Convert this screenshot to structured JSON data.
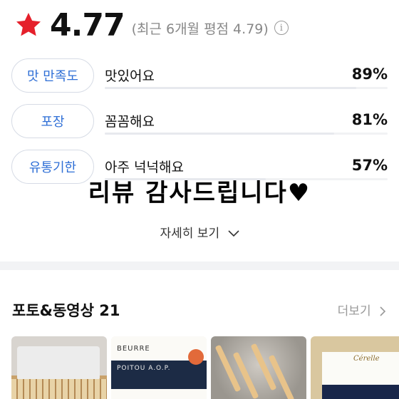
{
  "rating": {
    "score": "4.77",
    "recent_text": "(최근 6개월 평점 4.79)",
    "star_color": "#e5202b",
    "star_icon": "star-icon",
    "info_icon": "info-icon",
    "info_glyph": "i"
  },
  "criteria": [
    {
      "label": "맛 만족도",
      "description": "맛있어요",
      "percent": "89%",
      "fill": 0.89
    },
    {
      "label": "포장",
      "description": "꼼꼼해요",
      "percent": "81%",
      "fill": 0.81
    },
    {
      "label": "유통기한",
      "description": "아주 넉넉해요",
      "percent": "57%",
      "fill": 0.57
    }
  ],
  "overlay_text": "리뷰 감사드립니다♥",
  "detail_link": {
    "label": "자세히 보기",
    "icon": "chevron-down-icon"
  },
  "photos": {
    "title": "포토&동영상 21",
    "more_label": "더보기",
    "more_icon": "chevron-right-icon",
    "thumb_texts": {
      "t2_line1": "BEURRE",
      "t2_line2": "POITOU A.O.P.",
      "t4_logo": "Cérelle"
    }
  },
  "accent_color": "#2f6fd6"
}
